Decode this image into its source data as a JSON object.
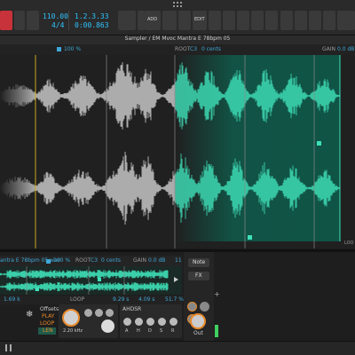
{
  "transport": {
    "tempo": "110.00",
    "time_signature": "4/4",
    "position_bars": "1.2.3.33",
    "position_time": "0:00.863",
    "add_label": "ADD",
    "edit_label": "EDIT"
  },
  "editor": {
    "title": "Sampler / EM Mvoc Mantra E 78bpm 05",
    "speed": "100 %",
    "root_label": "ROOT",
    "root_note": "C3",
    "root_cents": "0 cents",
    "gain_label": "GAIN",
    "gain_value": "0.0 dB",
    "corner_label": "LOO"
  },
  "device": {
    "sample_name": "antra E 78bpm 05.wav",
    "speed": "100 %",
    "root_label": "ROOT",
    "root_note": "C3",
    "root_cents": "0 cents",
    "gain_label": "GAIN",
    "gain_value": "0.0 dB",
    "top_right_value": "11",
    "freq1": "1.69 k",
    "loop_label": "LOOP",
    "val2": "9.29 s",
    "val3": "4.09 s",
    "pct": "51.7 %",
    "panel_buttons": [
      "Note",
      "FX"
    ],
    "effects_label": "Offsets",
    "effects_items": [
      "PLAY",
      "LOOP",
      "LEN"
    ],
    "filter_value": "2.20 kHz",
    "adsr_label": "AHDSR",
    "adsr_knobs": [
      "A",
      "H",
      "D",
      "S",
      "R"
    ],
    "out_label": "Out"
  },
  "colors": {
    "accent": "#3fe0b8",
    "tempo_blue": "#2ec4ff",
    "record_red": "#e83a3a",
    "marker_yellow": "#e6c21e",
    "knob_orange": "#e8892a"
  }
}
